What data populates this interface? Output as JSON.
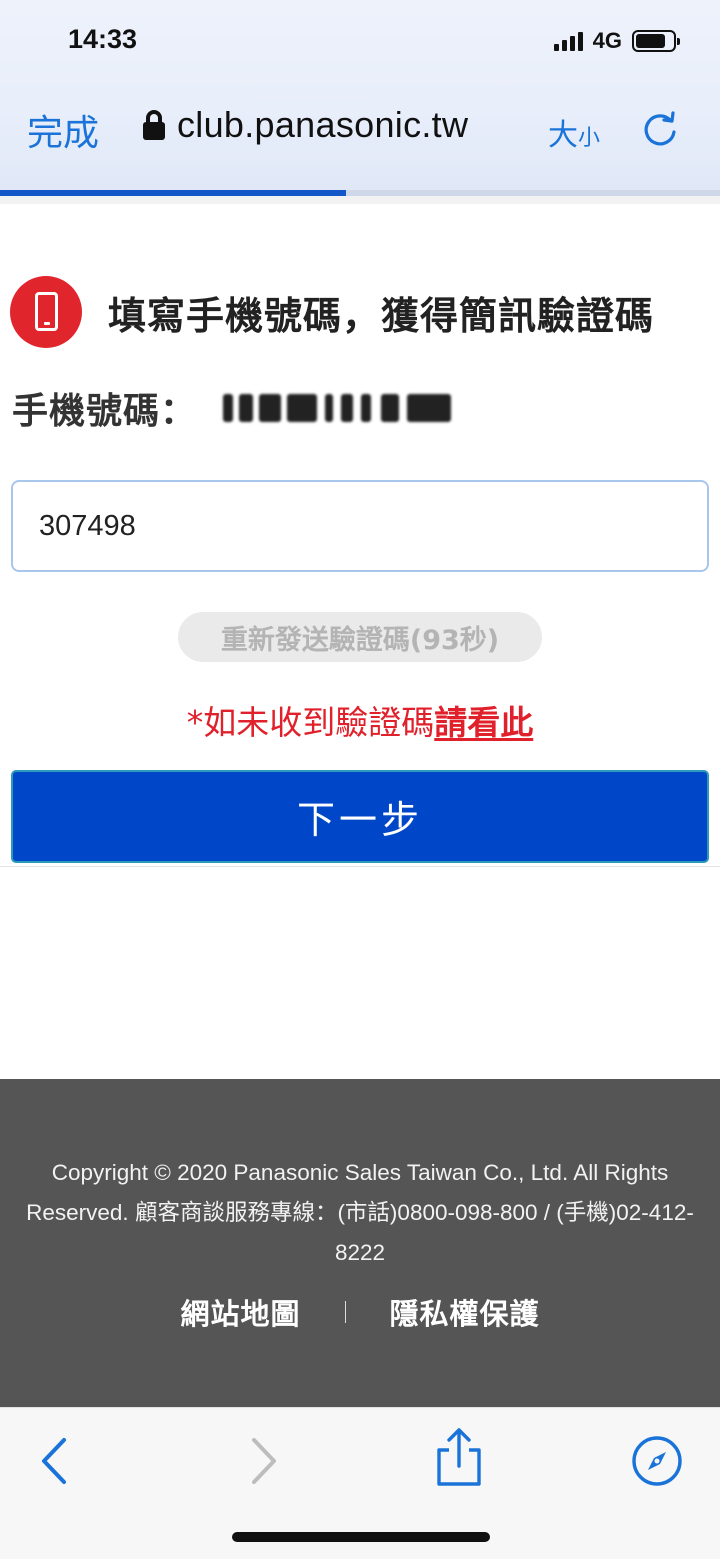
{
  "status_bar": {
    "time": "14:33",
    "network": "4G"
  },
  "browser": {
    "done_label": "完成",
    "url": "club.panasonic.tw",
    "text_size_big": "大",
    "text_size_small": "小",
    "load_progress": 0.48,
    "accent_color": "#1a73d9"
  },
  "form": {
    "title": "填寫手機號碼，獲得簡訊驗證碼",
    "phone_label": "手機號碼：",
    "code_value": "307498",
    "resend_label": "重新發送驗證碼(93秒)",
    "help_prefix": "*如未收到驗證碼",
    "help_link": "請看此",
    "next_label": "下一步",
    "primary_color": "#0046c8",
    "alert_color": "#e0202a"
  },
  "footer": {
    "copyright": "Copyright © 2020 Panasonic Sales Taiwan Co., Ltd. All Rights Reserved. 顧客商談服務專線：(市話)0800-098-800 / (手機)02-412-8222",
    "links": [
      "網站地圖",
      "隱私權保護"
    ]
  },
  "toolbar": {
    "icons": [
      "back-icon",
      "forward-icon",
      "share-icon",
      "compass-icon"
    ]
  }
}
